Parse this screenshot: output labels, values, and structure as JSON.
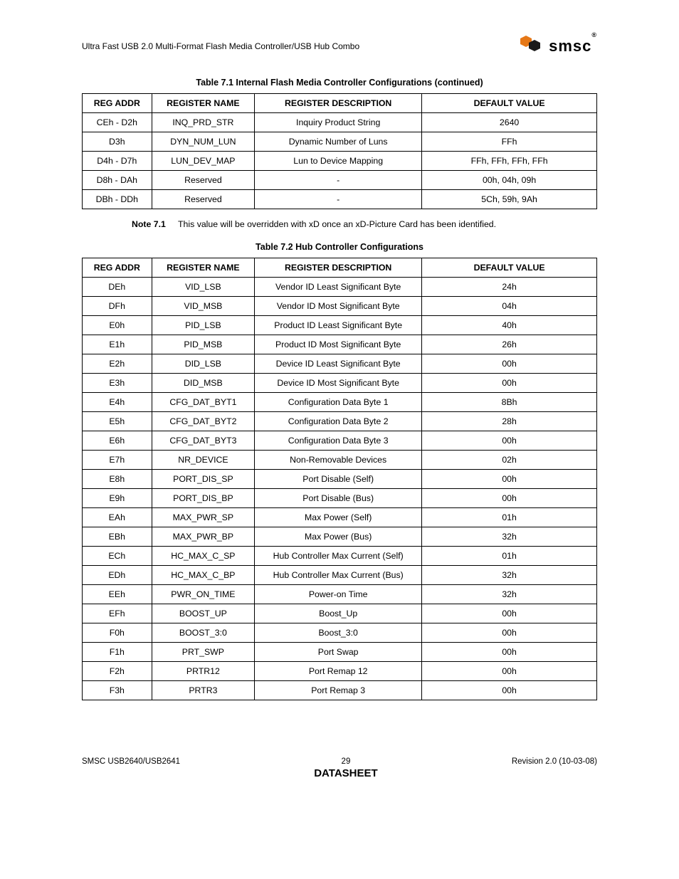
{
  "header": {
    "title": "Ultra Fast USB 2.0 Multi-Format Flash Media Controller/USB Hub Combo",
    "logo_text": "smsc",
    "logo_reg": "®"
  },
  "table1": {
    "title": "Table 7.1  Internal Flash Media Controller Configurations (continued)",
    "headers": [
      "REG ADDR",
      "REGISTER NAME",
      "REGISTER DESCRIPTION",
      "DEFAULT VALUE"
    ],
    "rows": [
      [
        "CEh - D2h",
        "INQ_PRD_STR",
        "Inquiry Product String",
        "2640"
      ],
      [
        "D3h",
        "DYN_NUM_LUN",
        "Dynamic Number of Luns",
        "FFh"
      ],
      [
        "D4h - D7h",
        "LUN_DEV_MAP",
        "Lun to Device Mapping",
        "FFh, FFh, FFh, FFh"
      ],
      [
        "D8h - DAh",
        "Reserved",
        "-",
        "00h, 04h, 09h"
      ],
      [
        "DBh - DDh",
        "Reserved",
        "-",
        "5Ch, 59h, 9Ah"
      ]
    ]
  },
  "note": {
    "label": "Note 7.1",
    "text": "This value will be overridden with xD once an xD-Picture Card has been identified."
  },
  "table2": {
    "title": "Table 7.2  Hub Controller Configurations",
    "headers": [
      "REG ADDR",
      "REGISTER NAME",
      "REGISTER DESCRIPTION",
      "DEFAULT VALUE"
    ],
    "rows": [
      [
        "DEh",
        "VID_LSB",
        "Vendor ID Least Significant Byte",
        "24h"
      ],
      [
        "DFh",
        "VID_MSB",
        "Vendor ID Most Significant Byte",
        "04h"
      ],
      [
        "E0h",
        "PID_LSB",
        "Product ID Least Significant Byte",
        "40h"
      ],
      [
        "E1h",
        "PID_MSB",
        "Product ID Most Significant Byte",
        "26h"
      ],
      [
        "E2h",
        "DID_LSB",
        "Device ID Least Significant Byte",
        "00h"
      ],
      [
        "E3h",
        "DID_MSB",
        "Device ID Most Significant Byte",
        "00h"
      ],
      [
        "E4h",
        "CFG_DAT_BYT1",
        "Configuration Data Byte 1",
        "8Bh"
      ],
      [
        "E5h",
        "CFG_DAT_BYT2",
        "Configuration Data Byte 2",
        "28h"
      ],
      [
        "E6h",
        "CFG_DAT_BYT3",
        "Configuration Data Byte 3",
        "00h"
      ],
      [
        "E7h",
        "NR_DEVICE",
        "Non-Removable Devices",
        "02h"
      ],
      [
        "E8h",
        "PORT_DIS_SP",
        "Port Disable (Self)",
        "00h"
      ],
      [
        "E9h",
        "PORT_DIS_BP",
        "Port Disable (Bus)",
        "00h"
      ],
      [
        "EAh",
        "MAX_PWR_SP",
        "Max Power (Self)",
        "01h"
      ],
      [
        "EBh",
        "MAX_PWR_BP",
        "Max Power (Bus)",
        "32h"
      ],
      [
        "ECh",
        "HC_MAX_C_SP",
        "Hub Controller Max Current (Self)",
        "01h"
      ],
      [
        "EDh",
        "HC_MAX_C_BP",
        "Hub Controller Max Current (Bus)",
        "32h"
      ],
      [
        "EEh",
        "PWR_ON_TIME",
        "Power-on Time",
        "32h"
      ],
      [
        "EFh",
        "BOOST_UP",
        "Boost_Up",
        "00h"
      ],
      [
        "F0h",
        "BOOST_3:0",
        "Boost_3:0",
        "00h"
      ],
      [
        "F1h",
        "PRT_SWP",
        "Port Swap",
        "00h"
      ],
      [
        "F2h",
        "PRTR12",
        "Port Remap 12",
        "00h"
      ],
      [
        "F3h",
        "PRTR3",
        "Port Remap 3",
        "00h"
      ]
    ]
  },
  "footer": {
    "left": "SMSC USB2640/USB2641",
    "page": "29",
    "datasheet": "DATASHEET",
    "right": "Revision 2.0 (10-03-08)"
  }
}
